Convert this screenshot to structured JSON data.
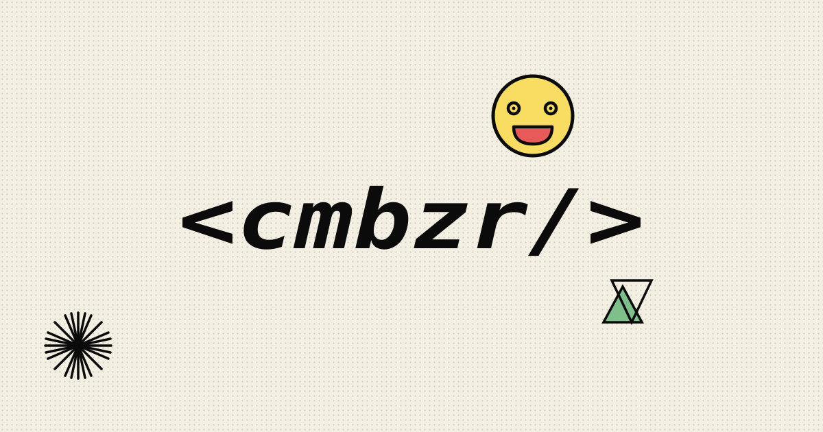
{
  "logo": {
    "text": "<cmbzr/>"
  },
  "decorations": {
    "smiley": {
      "icon": "smiley-face-icon",
      "face_color": "#f9dc62",
      "mouth_color": "#e85a5a",
      "outline_color": "#0b0b0b"
    },
    "starburst": {
      "icon": "starburst-icon",
      "color": "#0b0b0b"
    },
    "triangles": {
      "icon": "triangles-icon",
      "fill_color": "#7fbf8c",
      "outline_color": "#0b0b0b"
    }
  },
  "colors": {
    "background": "#f3efe2",
    "text": "#0b0b0b"
  }
}
